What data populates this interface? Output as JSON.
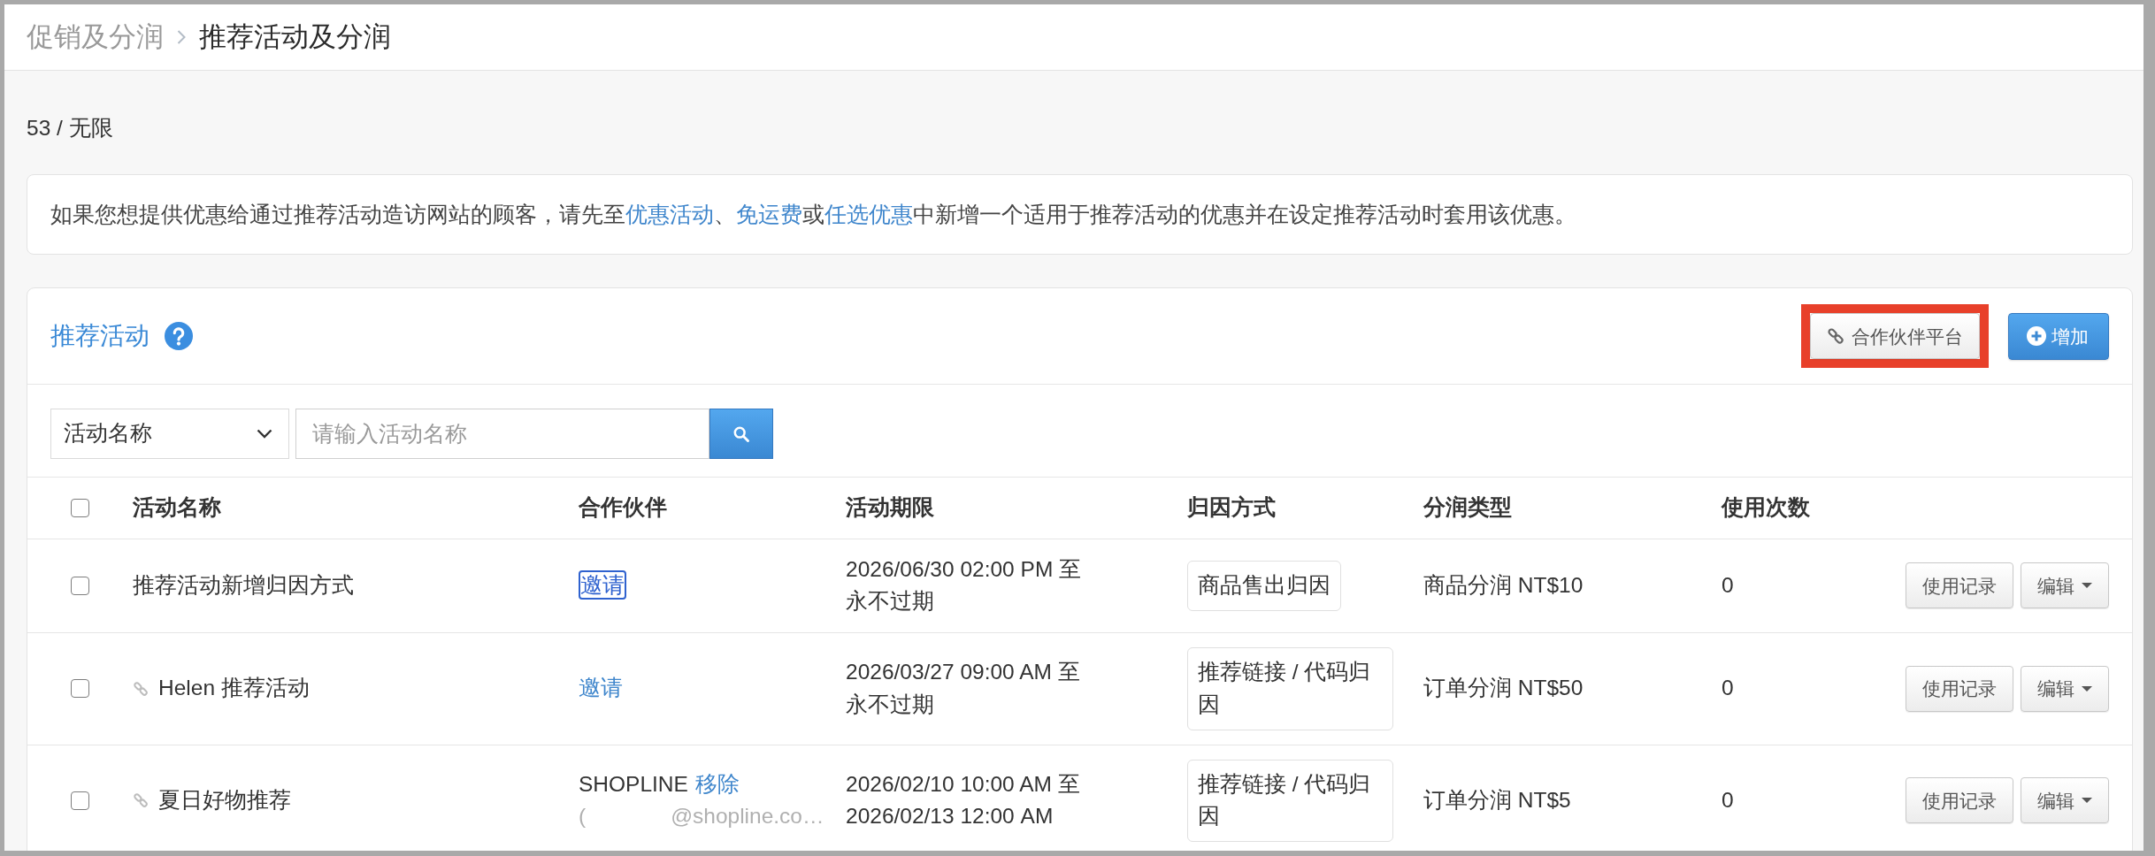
{
  "breadcrumb": [
    {
      "label": "促销及分润",
      "current": false
    },
    {
      "label": "推荐活动及分润",
      "current": true
    }
  ],
  "quota": "53 / 无限",
  "notice": {
    "parts": [
      {
        "kind": "text",
        "text": "如果您想提供优惠给通过推荐活动造访网站的顾客，请先至"
      },
      {
        "kind": "link",
        "text": "优惠活动"
      },
      {
        "kind": "text",
        "text": "、"
      },
      {
        "kind": "link",
        "text": "免运费"
      },
      {
        "kind": "text",
        "text": "或"
      },
      {
        "kind": "link",
        "text": "任选优惠"
      },
      {
        "kind": "text",
        "text": "中新增一个适用于推荐活动的优惠并在设定推荐活动时套用该优惠。"
      }
    ]
  },
  "panel": {
    "title": "推荐活动",
    "buttons": [
      {
        "kind": "partner",
        "label": "合作伙伴平台",
        "highlighted": true
      },
      {
        "kind": "add",
        "label": "增加",
        "highlighted": false
      }
    ]
  },
  "search": {
    "field": "活动名称",
    "placeholder": "请输入活动名称"
  },
  "table": {
    "all_checked": false,
    "columns": [
      "活动名称",
      "合作伙伴",
      "活动期限",
      "归因方式",
      "分润类型",
      "使用次数"
    ],
    "rows": [
      {
        "checked": false,
        "linked": false,
        "name": "推荐活动新增归因方式",
        "partner": {
          "kind": "invite",
          "action": "邀请",
          "focused": true
        },
        "period": "2026/06/30 02:00 PM 至永不过期",
        "attribution": "商品售出归因",
        "commission": "商品分润 NT$10",
        "uses": "0",
        "history_button": "使用记录",
        "edit_button": "编辑"
      },
      {
        "checked": false,
        "linked": true,
        "name": "Helen 推荐活动",
        "partner": {
          "kind": "invite",
          "action": "邀请",
          "focused": false
        },
        "period": "2026/03/27 09:00 AM 至永不过期",
        "attribution": "推荐链接 / 代码归因",
        "commission": "订单分润 NT$50",
        "uses": "0",
        "history_button": "使用记录",
        "edit_button": "编辑"
      },
      {
        "checked": false,
        "linked": true,
        "name": "夏日好物推荐",
        "partner": {
          "kind": "assigned",
          "name": "SHOPLINE",
          "action": "移除",
          "focused": false,
          "email": [
            "(",
            "@shopline.co…"
          ]
        },
        "period": "2026/02/10 10:00 AM 至 2026/02/13 12:00 AM",
        "attribution": "推荐链接 / 代码归因",
        "commission": "订单分润 NT$5",
        "uses": "0",
        "history_button": "使用记录",
        "edit_button": "编辑"
      }
    ]
  }
}
